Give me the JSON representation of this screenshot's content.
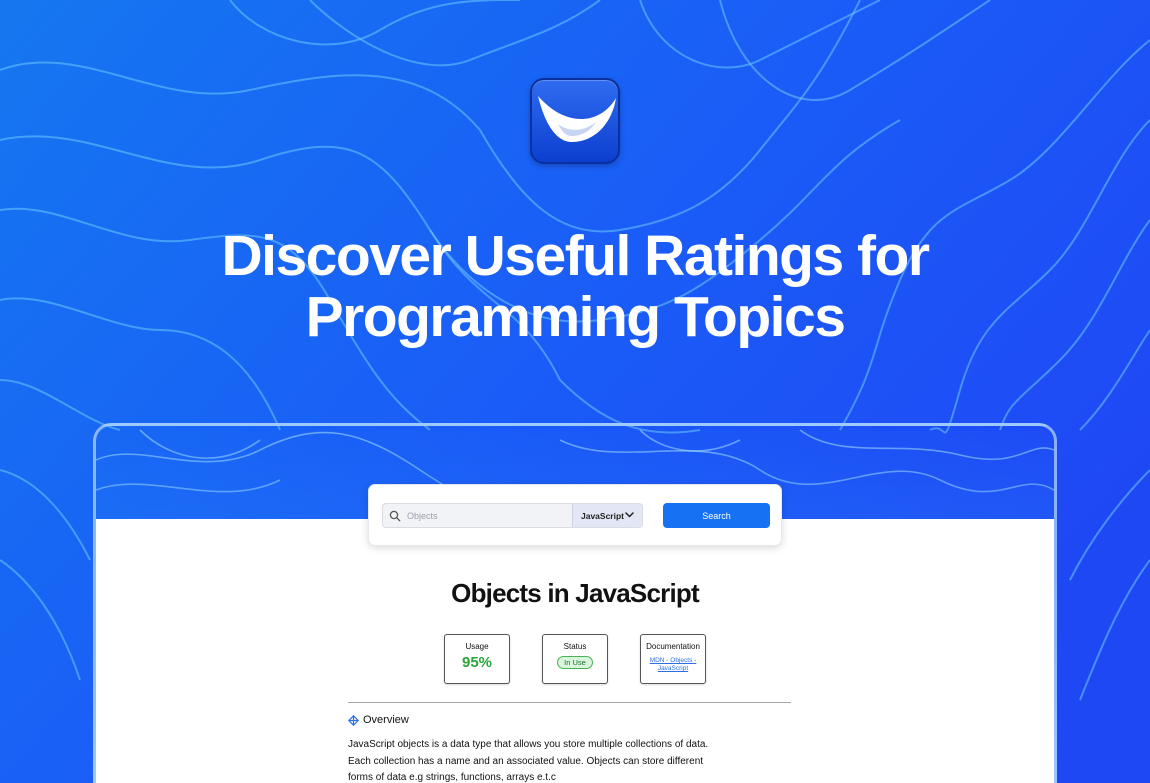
{
  "headline": {
    "line1": "Discover Useful Ratings for",
    "line2": "Programming Topics"
  },
  "icons": {
    "logo": "smile-check-logo-icon",
    "search": "search-icon",
    "dropdown": "chevron-down-icon",
    "overview": "diamond-cross-icon"
  },
  "colors": {
    "background": "#1a5cf5",
    "accent": "#1672f2",
    "usage_value": "#2aa63a"
  },
  "search": {
    "placeholder": "Objects",
    "language": "JavaScript",
    "button_label": "Search"
  },
  "topic": {
    "title": "Objects in JavaScript",
    "stats": {
      "usage": {
        "label": "Usage",
        "value": "95%"
      },
      "status": {
        "label": "Status",
        "value": "In Use"
      },
      "documentation": {
        "label": "Documentation",
        "link_text": "MDN - Objects - JavaScript"
      }
    },
    "overview_label": "Overview",
    "description": [
      "JavaScript objects is a data type that allows you store multiple collections of data.",
      "Each collection has a name and an associated value. Objects can store different",
      "forms of data e.g strings, functions, arrays e.t.c"
    ]
  }
}
